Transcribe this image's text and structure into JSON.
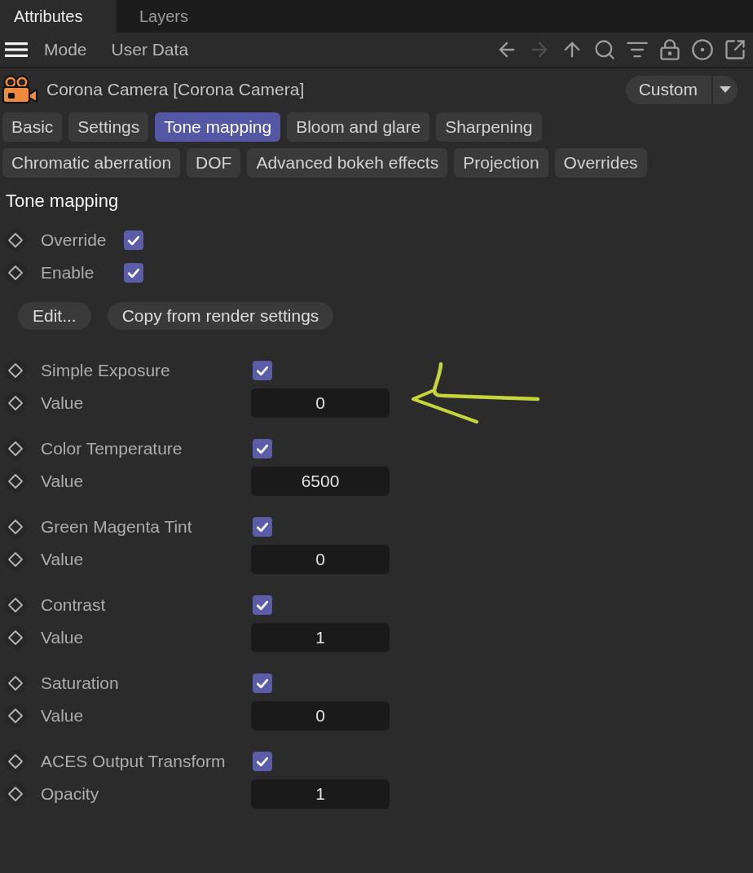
{
  "panel_tabs": [
    {
      "label": "Attributes",
      "selected": true
    },
    {
      "label": "Layers",
      "selected": false
    }
  ],
  "toolbar": {
    "menus": [
      "Mode",
      "User Data"
    ],
    "icons": [
      {
        "kind": "back",
        "disabled": false
      },
      {
        "kind": "forward",
        "disabled": true
      },
      {
        "kind": "up",
        "disabled": false
      },
      {
        "kind": "search",
        "disabled": false
      },
      {
        "kind": "filter",
        "disabled": false
      },
      {
        "kind": "lock",
        "disabled": false
      },
      {
        "kind": "target",
        "disabled": false
      },
      {
        "kind": "new-window",
        "disabled": false
      }
    ]
  },
  "object": {
    "title": "Corona Camera [Corona Camera]",
    "preset": "Custom"
  },
  "tab_rows": [
    {
      "tabs": [
        {
          "label": "Basic",
          "selected": false
        },
        {
          "label": "Settings",
          "selected": false
        },
        {
          "label": "Tone mapping",
          "selected": true
        },
        {
          "label": "Bloom and glare",
          "selected": false
        },
        {
          "label": "Sharpening",
          "selected": false
        }
      ]
    },
    {
      "tabs": [
        {
          "label": "Chromatic aberration",
          "selected": false
        },
        {
          "label": "DOF",
          "selected": false
        },
        {
          "label": "Advanced bokeh effects",
          "selected": false
        },
        {
          "label": "Projection",
          "selected": false
        },
        {
          "label": "Overrides",
          "selected": false
        }
      ]
    }
  ],
  "section": {
    "title": "Tone mapping",
    "toggles": [
      {
        "label": "Override",
        "checked": true
      },
      {
        "label": "Enable",
        "checked": true
      }
    ],
    "buttons": [
      "Edit...",
      "Copy from render settings"
    ],
    "parameter_groups": [
      {
        "toggle": {
          "label": "Simple Exposure",
          "checked": true
        },
        "field": {
          "label": "Value",
          "value": "0"
        }
      },
      {
        "toggle": {
          "label": "Color Temperature",
          "checked": true
        },
        "field": {
          "label": "Value",
          "value": "6500"
        }
      },
      {
        "toggle": {
          "label": "Green Magenta Tint",
          "checked": true
        },
        "field": {
          "label": "Value",
          "value": "0"
        }
      },
      {
        "toggle": {
          "label": "Contrast",
          "checked": true
        },
        "field": {
          "label": "Value",
          "value": "1"
        }
      },
      {
        "toggle": {
          "label": "Saturation",
          "checked": true
        },
        "field": {
          "label": "Value",
          "value": "0"
        }
      },
      {
        "toggle": {
          "label": "ACES Output Transform",
          "checked": true
        },
        "field": {
          "label": "Opacity",
          "value": "1"
        }
      }
    ]
  }
}
